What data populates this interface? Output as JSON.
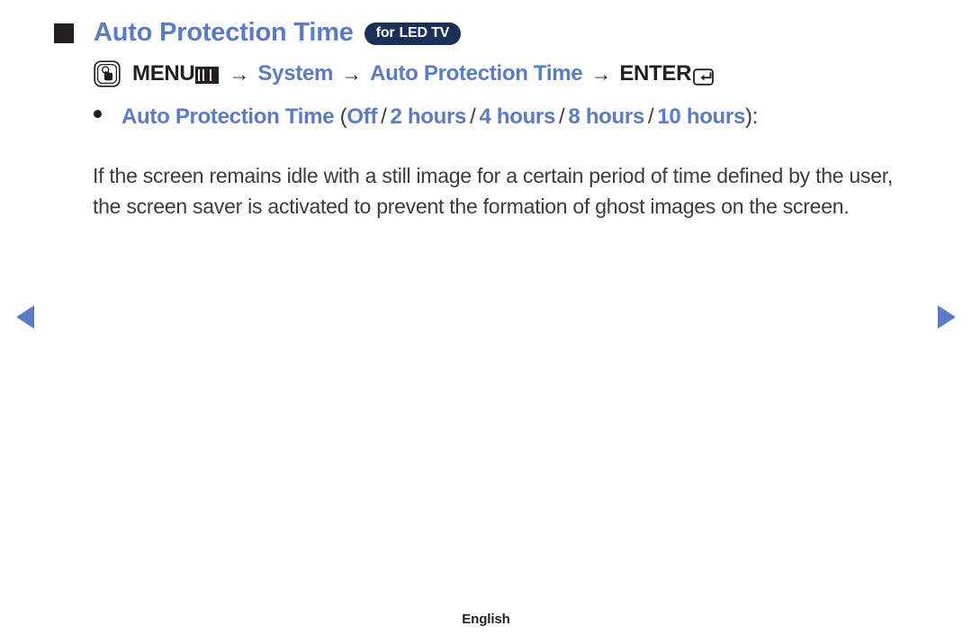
{
  "heading": {
    "bullet_icon": "square-bullet-icon",
    "title": "Auto Protection Time",
    "badge": {
      "prefix": "for",
      "model": "LED TV",
      "bg_color": "#1b3059",
      "text_color": "#ffffff"
    }
  },
  "menu_path": {
    "icon": "press-button-hand-icon",
    "menu_label": "MENU",
    "menu_glyph_icon": "menu-bars-icon",
    "arrow": "→",
    "step_system": "System",
    "step_feature": "Auto Protection Time",
    "enter_label": "ENTER",
    "enter_glyph_icon": "enter-key-icon"
  },
  "option_line": {
    "bullet_icon": "round-bullet-icon",
    "label": "Auto Protection Time",
    "open_paren": "(",
    "options": [
      "Off",
      "2 hours",
      "4 hours",
      "8 hours",
      "10 hours"
    ],
    "separator": "/",
    "close_paren": ")",
    "colon": ":"
  },
  "body": {
    "paragraph": "If the screen remains idle with a still image for a certain period of time defined by the user, the screen saver is activated to prevent the formation of ghost images on the screen."
  },
  "navigation": {
    "prev_icon": "triangle-left-icon",
    "next_icon": "triangle-right-icon",
    "arrow_color": "#5b7bc4"
  },
  "footer": {
    "language": "English"
  },
  "colors": {
    "accent_blue": "#5b7bc4",
    "text_dark": "#3e3a3b",
    "ink_black": "#231f20",
    "badge_navy": "#1b3059",
    "background": "#ffffff"
  }
}
